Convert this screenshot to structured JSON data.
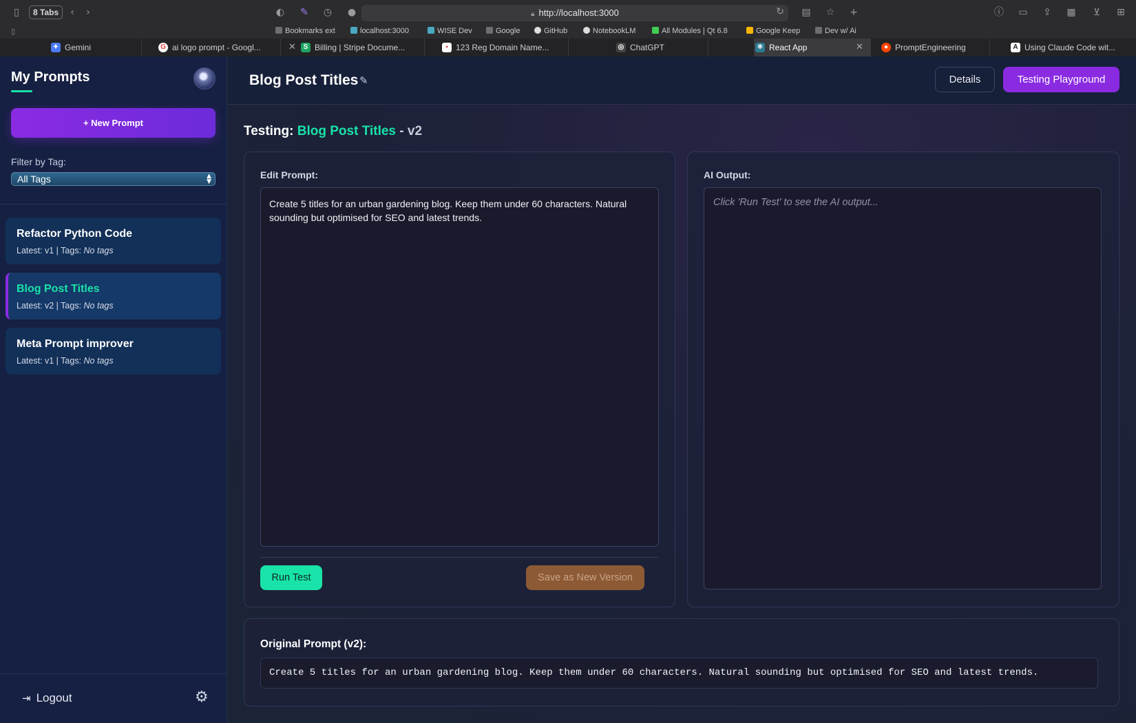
{
  "browser": {
    "tabs_count": "8 Tabs",
    "url": "http://localhost:3000",
    "bookmarks": [
      {
        "label": "Bookmarks ext",
        "color": "#8e8e93"
      },
      {
        "label": "localhost:3000",
        "color": "#4aa8c0"
      },
      {
        "label": "WISE Dev",
        "color": "#4aa8c0"
      },
      {
        "label": "Google",
        "color": "#8e8e93"
      },
      {
        "label": "GitHub",
        "color": "#dddddd"
      },
      {
        "label": "NotebookLM",
        "color": "#dddddd"
      },
      {
        "label": "All Modules | Qt 6.8",
        "color": "#41cd52"
      },
      {
        "label": "Google Keep",
        "color": "#f7b500"
      },
      {
        "label": "Dev w/ Ai",
        "color": "#8e8e93"
      }
    ],
    "tabs": [
      {
        "label": "Gemini",
        "fav": "✦",
        "color": "#4a7bf7"
      },
      {
        "label": "ai logo prompt - Googl...",
        "fav": "G",
        "color": "#ea4335"
      },
      {
        "label": "Billing | Stripe Docume...",
        "fav": "S",
        "color": "#1fa463"
      },
      {
        "label": "123 Reg Domain Name...",
        "fav": "▪",
        "color": "#e0464b"
      },
      {
        "label": "ChatGPT",
        "fav": "◎",
        "color": "#444444"
      },
      {
        "label": "React App",
        "fav": "⚛",
        "color": "#2b7a8f"
      },
      {
        "label": "PromptEngineering",
        "fav": "●",
        "color": "#ff4500"
      },
      {
        "label": "Using Claude Code wit...",
        "fav": "A",
        "color": "#222222"
      }
    ]
  },
  "sidebar": {
    "title": "My Prompts",
    "new_prompt_label": "+ New Prompt",
    "filter_label": "Filter by Tag:",
    "filter_value": "All Tags",
    "prompts": [
      {
        "name": "Refactor Python Code",
        "latest": "Latest: v1 | Tags: ",
        "tags": "No tags"
      },
      {
        "name": "Blog Post Titles",
        "latest": "Latest: v2 | Tags: ",
        "tags": "No tags"
      },
      {
        "name": "Meta Prompt improver",
        "latest": "Latest: v1 | Tags: ",
        "tags": "No tags"
      }
    ],
    "logout_label": "Logout"
  },
  "header": {
    "title": "Blog Post Titles",
    "details_label": "Details",
    "playground_label": "Testing Playground"
  },
  "testing": {
    "prefix": "Testing: ",
    "prompt_name": "Blog Post Titles",
    "version": " - v2"
  },
  "editor": {
    "label": "Edit Prompt:",
    "value": "Create 5 titles for an urban gardening blog. Keep them under 60 characters. Natural sounding but optimised for SEO and latest trends.",
    "run_label": "Run Test",
    "save_label": "Save as New Version"
  },
  "output": {
    "label": "AI Output:",
    "placeholder": "Click 'Run Test' to see the AI output..."
  },
  "original": {
    "label": "Original Prompt (v2):",
    "text": "Create 5 titles for an urban gardening blog. Keep them under 60 characters. Natural sounding but optimised for SEO and latest trends."
  }
}
